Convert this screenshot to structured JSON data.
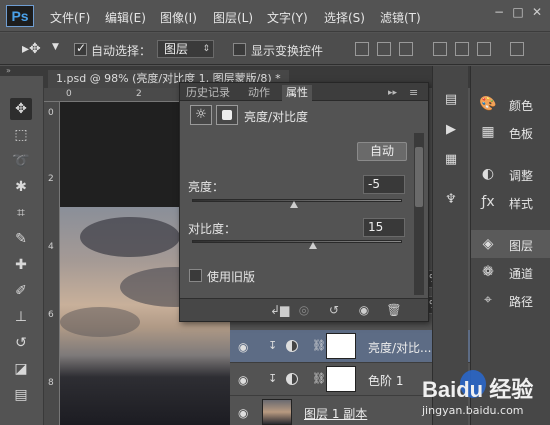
{
  "app": {
    "logo": "Ps"
  },
  "menu": [
    "文件(F)",
    "编辑(E)",
    "图像(I)",
    "图层(L)",
    "文字(Y)",
    "选择(S)",
    "滤镜(T)"
  ],
  "window_controls": [
    "−",
    "□",
    "✕"
  ],
  "options_bar": {
    "auto_select_label": "自动选择：",
    "auto_select_checked": true,
    "auto_select_value": "图层",
    "show_transform_label": "显示变换控件",
    "show_transform_checked": false
  },
  "document": {
    "tab_label": "1.psd @ 98% (亮度/对比度 1, 图层蒙版/8) *",
    "ruler_h": [
      "0",
      "2"
    ],
    "ruler_v": [
      "0",
      "2",
      "4",
      "6",
      "8"
    ]
  },
  "properties_panel": {
    "tabs": [
      "历史记录",
      "动作",
      "属性"
    ],
    "active_tab": "属性",
    "title": "亮度/对比度",
    "auto_button": "自动",
    "brightness_label": "亮度：",
    "brightness_value": "-5",
    "contrast_label": "对比度：",
    "contrast_value": "15",
    "legacy_label": "使用旧版",
    "legacy_checked": false
  },
  "layers_panel": {
    "opacity_value": "%",
    "fill_value": "%",
    "layers": [
      {
        "name": "亮度/对比...",
        "selected": true
      },
      {
        "name": "色阶 1",
        "selected": false
      },
      {
        "name": "图层 1 副本",
        "selected": false
      }
    ]
  },
  "dock": {
    "items": [
      {
        "label": "颜色",
        "icon": "palette-icon"
      },
      {
        "label": "色板",
        "icon": "swatches-icon"
      },
      {
        "label": "调整",
        "icon": "adjustments-icon"
      },
      {
        "label": "样式",
        "icon": "styles-icon"
      },
      {
        "label": "图层",
        "icon": "layers-icon",
        "active": true
      },
      {
        "label": "通道",
        "icon": "channels-icon"
      },
      {
        "label": "路径",
        "icon": "paths-icon"
      }
    ]
  },
  "watermark": {
    "main": "Baidu 经验",
    "sub": "jingyan.baidu.com"
  },
  "colors": {
    "panel_bg": "#535353",
    "selected_layer": "#5d6c85",
    "logo_blue": "#4aa0e8"
  }
}
